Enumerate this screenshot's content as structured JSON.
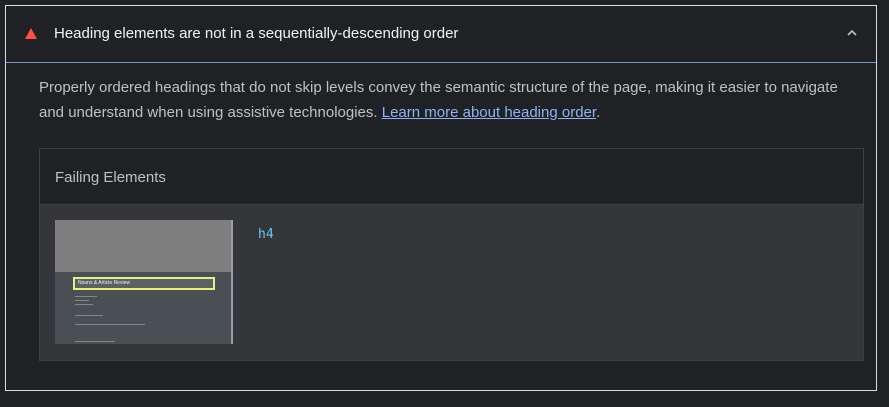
{
  "audit": {
    "title": "Heading elements are not in a sequentially-descending order",
    "description": "Properly ordered headings that do not skip levels convey the semantic structure of the page, making it easier to navigate and understand when using assistive technologies. ",
    "link_text": "Learn more about heading order",
    "trailing_period": ".",
    "status_color": "#ff4e42",
    "icons": {
      "status": "warning-triangle-icon",
      "toggle": "chevron-up-icon"
    }
  },
  "failing_elements": {
    "header": "Failing Elements",
    "items": [
      {
        "node": "h4",
        "thumbnail_heading": "Nouns & Article Review"
      }
    ]
  }
}
